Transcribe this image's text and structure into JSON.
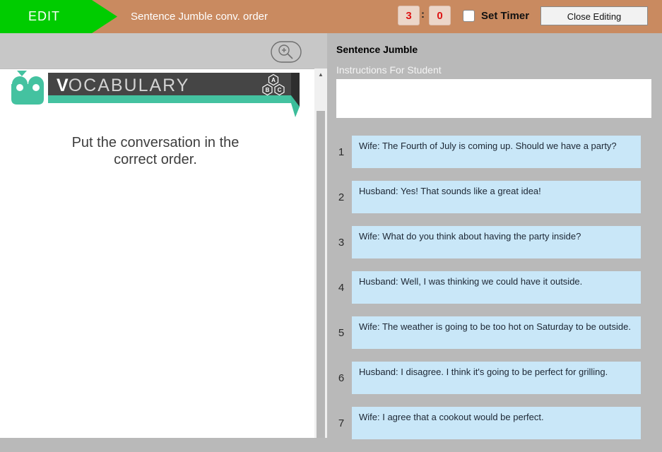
{
  "header": {
    "edit_label": "EDIT",
    "title": "Sentence Jumble conv. order",
    "timer": {
      "minutes": "3",
      "seconds": "0",
      "separator": ":"
    },
    "set_timer_label": "Set Timer",
    "close_button_label": "Close Editing",
    "colors": {
      "bar": "#c98a60",
      "edit_flag": "#00cc00",
      "timer_digit": "#dd1414",
      "timer_bg": "#ecd6c9"
    }
  },
  "preview": {
    "toolbar": {
      "zoom_icon": "magnifier-plus"
    },
    "slide": {
      "banner_title": "VOCABULARY",
      "banner_icon": "abc-hexagons",
      "banner_colors": {
        "teal": "#44c2a0",
        "dark": "#454545"
      },
      "prompt": "Put the conversation in the correct order."
    },
    "scrollbar_up_glyph": "▲"
  },
  "editor": {
    "panel_title": "Sentence Jumble",
    "instructions_label": "Instructions For Student",
    "instructions_value": "",
    "sentences": [
      {
        "number": "1",
        "text": "Wife: The Fourth of July is coming up. Should we have a party?"
      },
      {
        "number": "2",
        "text": "Husband: Yes! That sounds like a great idea!"
      },
      {
        "number": "3",
        "text": "Wife: What do you think about having the party inside?"
      },
      {
        "number": "4",
        "text": "Husband: Well, I was thinking we could have it outside."
      },
      {
        "number": "5",
        "text": "Wife: The weather is going to be too hot on Saturday to be outside."
      },
      {
        "number": "6",
        "text": "Husband: I disagree. I think it's going to be perfect for grilling."
      },
      {
        "number": "7",
        "text": "Wife: I agree that a cookout would be perfect."
      }
    ],
    "colors": {
      "panel_bg": "#b9b9b9",
      "item_bg": "#c9e7f8"
    }
  }
}
